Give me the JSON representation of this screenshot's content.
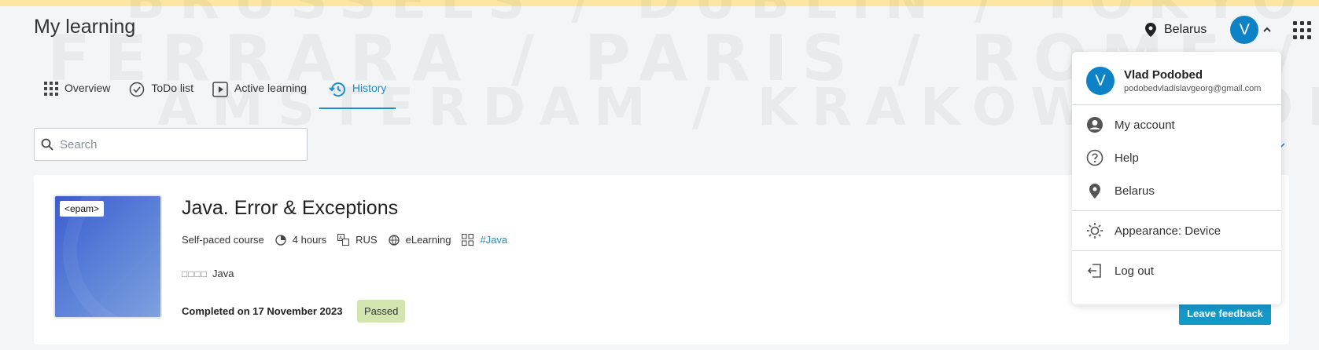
{
  "page": {
    "title": "My learning"
  },
  "header": {
    "location": "Belarus",
    "avatar_initial": "V"
  },
  "tabs": [
    {
      "label": "Overview",
      "icon": "grid-icon"
    },
    {
      "label": "ToDo list",
      "icon": "check-circle-icon"
    },
    {
      "label": "Active learning",
      "icon": "play-icon"
    },
    {
      "label": "History",
      "icon": "history-icon",
      "active": true
    }
  ],
  "search": {
    "placeholder": "Search",
    "value": ""
  },
  "course": {
    "thumbnail_logo": "<epam>",
    "title": "Java. Error & Exceptions",
    "type": "Self-paced course",
    "duration": "4 hours",
    "language": "RUS",
    "format": "eLearning",
    "tag": "#Java",
    "skill_rating_glyphs": "□□□□",
    "skill": "Java",
    "completed": "Completed on 17 November 2023",
    "status": "Passed",
    "feedback_button": "Leave feedback"
  },
  "dropdown": {
    "avatar_initial": "V",
    "name": "Vlad Podobed",
    "email": "podobedvladislavgeorg@gmail.com",
    "items": [
      {
        "label": "My account",
        "icon": "account-icon"
      },
      {
        "label": "Help",
        "icon": "help-icon"
      },
      {
        "label": "Belarus",
        "icon": "location-icon"
      }
    ],
    "appearance": "Appearance: Device",
    "logout": "Log out"
  },
  "colors": {
    "accent": "#1b8fcb",
    "avatar": "#0d82c4",
    "passed_badge": "#d4e6b0",
    "button": "#1498c9"
  }
}
